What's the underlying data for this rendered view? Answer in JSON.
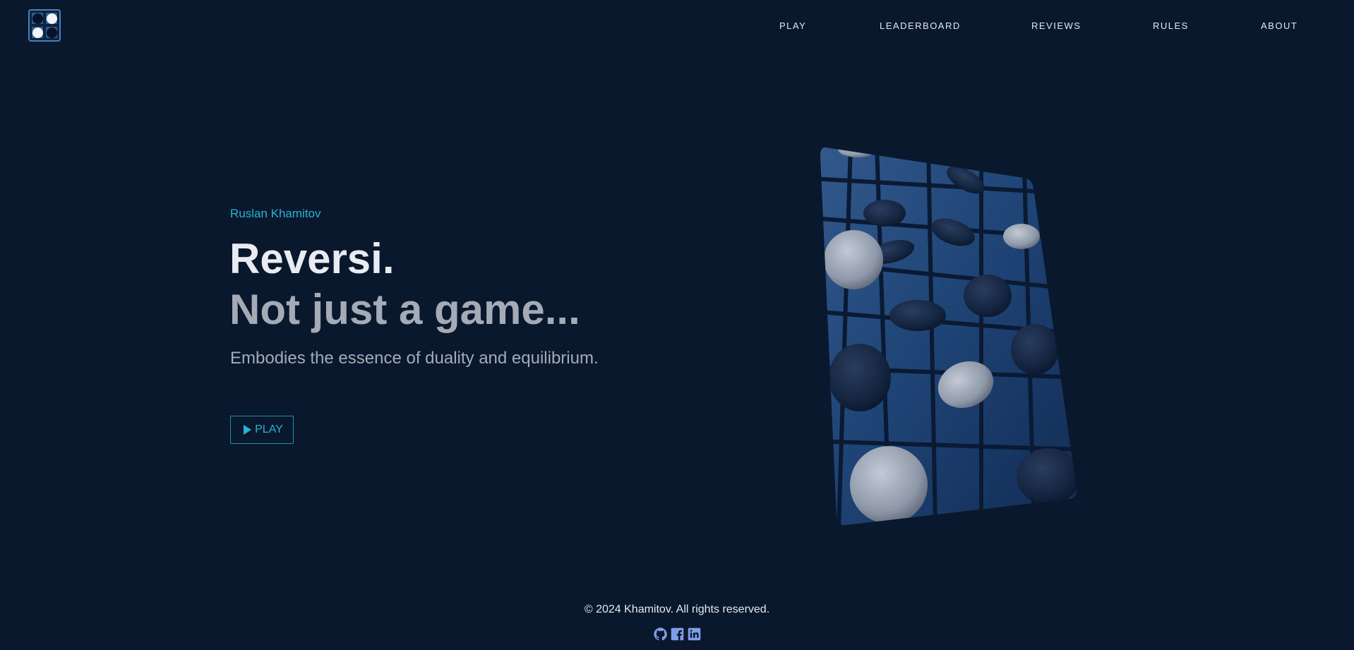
{
  "header": {
    "logo": {
      "icon": "reversi-board-logo-icon",
      "discs": [
        "dark",
        "light",
        "light",
        "dark"
      ]
    },
    "nav": [
      {
        "label": "PLAY"
      },
      {
        "label": "LEADERBOARD"
      },
      {
        "label": "REVIEWS"
      },
      {
        "label": "RULES"
      },
      {
        "label": "ABOUT"
      }
    ]
  },
  "hero": {
    "author": "Ruslan Khamitov",
    "title_line1": "Reversi.",
    "title_line2": "Not just a game...",
    "tagline": "Embodies the essence of duality and equilibrium.",
    "play_button": {
      "label": "PLAY",
      "icon": "play-triangle-icon"
    },
    "image": {
      "subject": "tilted reversi board with pieces"
    }
  },
  "footer": {
    "copyright": "© 2024 Khamitov. All rights reserved.",
    "socials": [
      {
        "icon": "github-icon"
      },
      {
        "icon": "facebook-icon"
      },
      {
        "icon": "linkedin-icon"
      }
    ]
  },
  "colors": {
    "background": "#0a182d",
    "accent": "#27b3d6",
    "title_primary": "#e8ebf1",
    "title_secondary": "#a4abb6",
    "social_icons": "#7f9ee8"
  }
}
